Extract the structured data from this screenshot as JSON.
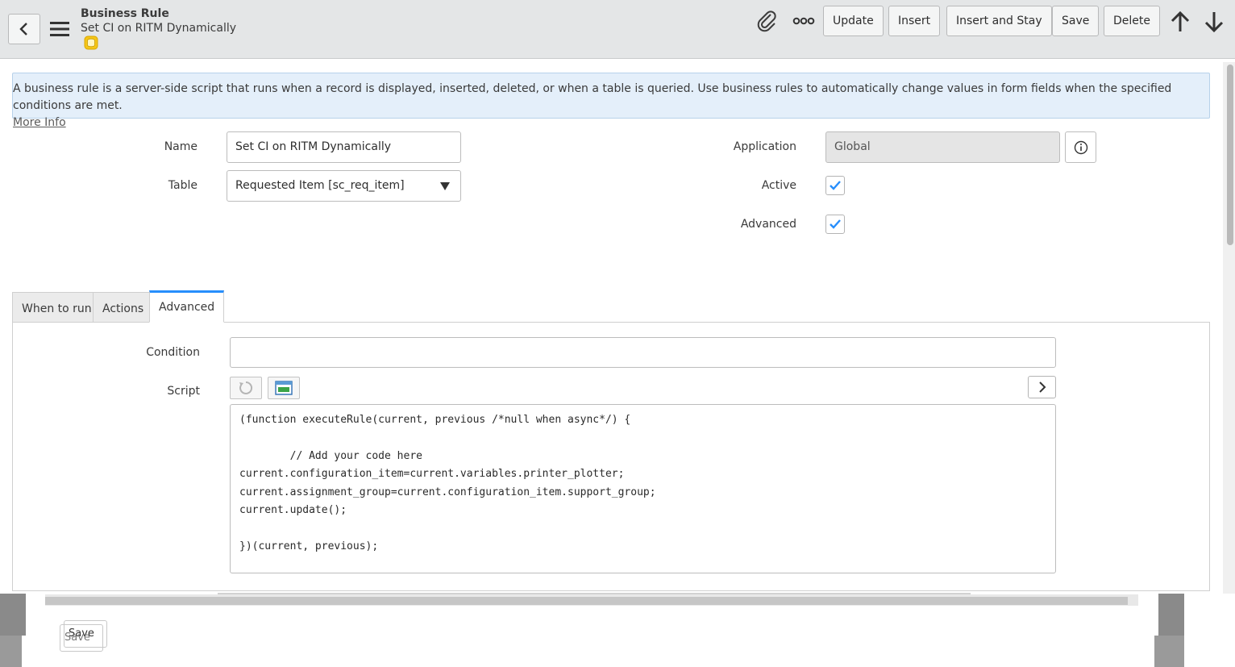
{
  "header": {
    "title": "Business Rule",
    "subtitle": "Set CI on RITM Dynamically",
    "buttons": {
      "update": "Update",
      "insert": "Insert",
      "insert_and_stay": "Insert and Stay",
      "save": "Save",
      "delete": "Delete"
    },
    "icons": [
      "back-icon",
      "hamburger-menu-icon",
      "database-icon",
      "paperclip-icon",
      "more-options-icon",
      "arrow-up-icon",
      "arrow-down-icon"
    ]
  },
  "info_banner": {
    "text": "A business rule is a server-side script that runs when a record is displayed, inserted, deleted, or when a table is queried. Use business rules to automatically change values in form fields when the specified conditions are met.",
    "more_info": "More Info"
  },
  "form": {
    "name_label": "Name",
    "name_value": "Set CI on RITM Dynamically",
    "table_label": "Table",
    "table_value": "Requested Item [sc_req_item]",
    "application_label": "Application",
    "application_value": "Global",
    "active_label": "Active",
    "active_checked": true,
    "advanced_label": "Advanced",
    "advanced_checked": true
  },
  "tabs": [
    {
      "label": "When to run",
      "active": false
    },
    {
      "label": "Actions",
      "active": false
    },
    {
      "label": "Advanced",
      "active": true
    }
  ],
  "advanced": {
    "condition_label": "Condition",
    "condition_value": "",
    "script_label": "Script",
    "script_lines": [
      "(function executeRule(current, previous /*null when async*/) {",
      "",
      "        // Add your code here",
      "current.configuration_item=current.variables.printer_plotter;",
      "current.assignment_group=current.configuration_item.support_group;",
      "current.update();",
      "",
      "})(current, previous);"
    ]
  },
  "footer": {
    "save_a": "Save",
    "save_b": "Save"
  },
  "colors": {
    "header_bg": "#e4e6e7",
    "banner_bg": "#e4effa",
    "accent": "#278efc",
    "check": "#278efc"
  }
}
